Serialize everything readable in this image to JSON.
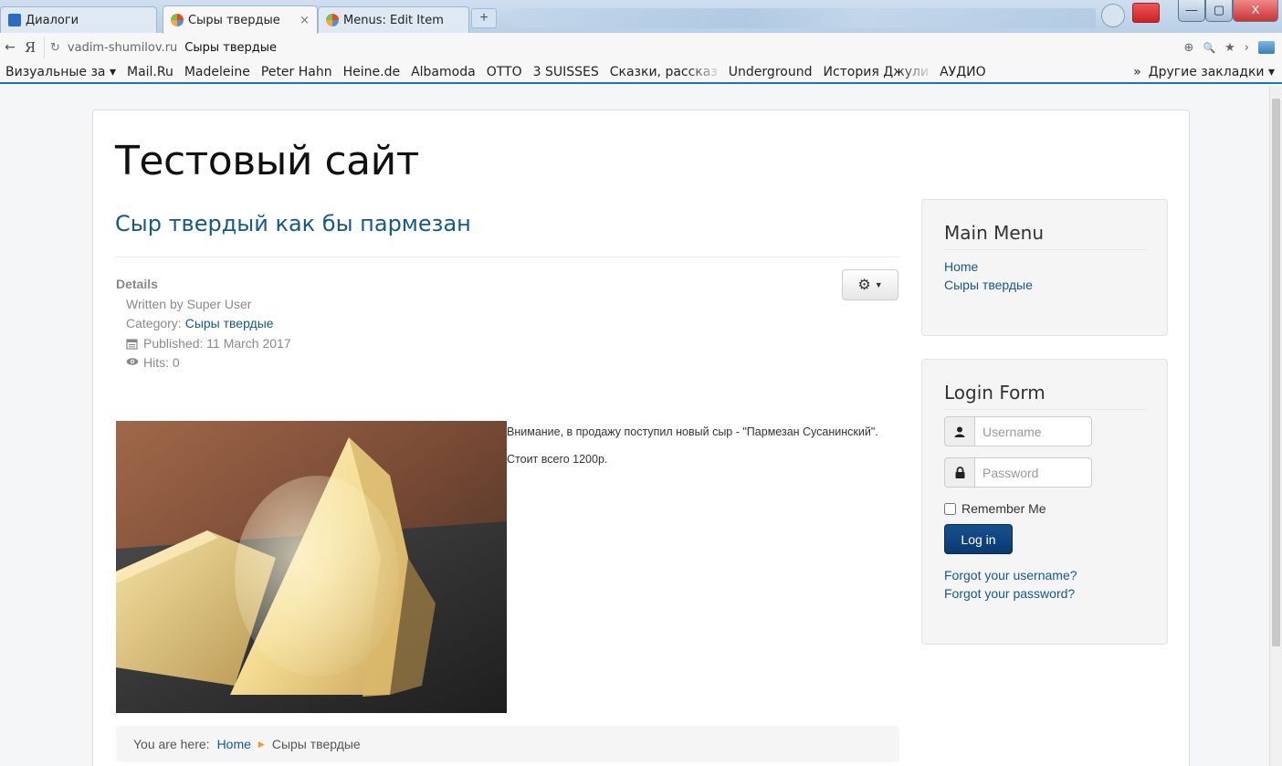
{
  "browser": {
    "tabs": [
      {
        "label": "Диалоги"
      },
      {
        "label": "Сыры твердые",
        "close": "×"
      },
      {
        "label": "Menus: Edit Item"
      }
    ],
    "new_tab": "+",
    "back": "←",
    "yandex": "Я",
    "reload": "↻",
    "address": {
      "domain": "vadim-shumilov.ru",
      "page_title": "Сыры твердые"
    },
    "address_icons": {
      "zoom": "⊕",
      "search": "🔍",
      "star": "★",
      "arrow": "›"
    },
    "window_buttons": {
      "minimize": "—",
      "maximize": "▢",
      "close": "X"
    },
    "bookmarks": [
      "Визуальные за ▾",
      "Mail.Ru",
      "Madeleine",
      "Peter Hahn",
      "Heine.de",
      "Albamoda",
      "OTTO",
      "3 SUISSES",
      "Сказки, рассказ",
      "Underground",
      "История Джули",
      "АУДИО"
    ],
    "bookmarks_more": "»",
    "other_bookmarks": "Другие закладки ▾"
  },
  "site": {
    "brand": "Тестовый сайт",
    "article": {
      "title": "Сыр твердый как бы пармезан",
      "details_label": "Details",
      "written_by": "Written by Super User",
      "category_label": "Category:",
      "category_link": "Сыры твердые",
      "published": "Published: 11 March 2017",
      "hits": "Hits: 0",
      "paragraph1": "Внимание, в продажу поступил новый сыр - \"Пармезан Сусанинский\".",
      "paragraph2": "Стоит всего 1200р."
    },
    "breadcrumb": {
      "prefix": "You are here:",
      "home": "Home",
      "current": "Сыры твердые"
    },
    "main_menu": {
      "title": "Main Menu",
      "items": [
        "Home",
        "Сыры твердые"
      ]
    },
    "login_form": {
      "title": "Login Form",
      "username_placeholder": "Username",
      "password_placeholder": "Password",
      "remember_label": "Remember Me",
      "login_button": "Log in",
      "forgot_username": "Forgot your username?",
      "forgot_password": "Forgot your password?"
    }
  },
  "colors": {
    "link": "#15598a",
    "brand_text": "#111111",
    "login_button": "#0f4a85",
    "breadcrumb_separator": "#f39a1a"
  }
}
